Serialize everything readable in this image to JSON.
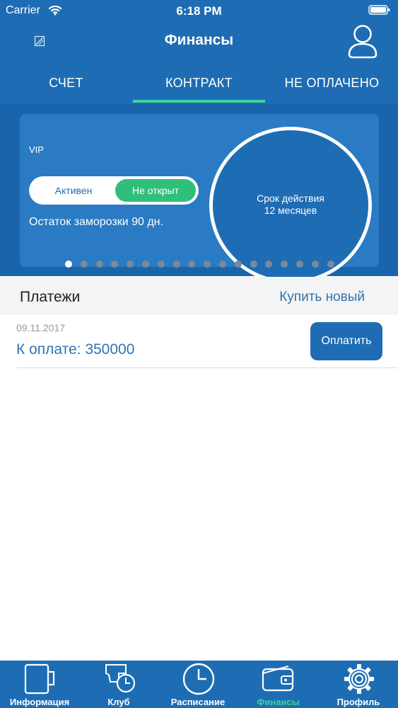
{
  "status_bar": {
    "carrier": "Carrier",
    "time": "6:18 PM"
  },
  "nav": {
    "title": "Финансы",
    "left_icon": "edit-icon",
    "right_icon": "user-icon"
  },
  "tabs": [
    {
      "label": "СЧЕТ"
    },
    {
      "label": "КОНТРАКТ",
      "selected": true
    },
    {
      "label": "НЕ ОПЛАЧЕНО"
    }
  ],
  "contract_card": {
    "type": "VIP",
    "status_left": "Активен",
    "status_right": "Не открыт",
    "freeze_remaining": "Остаток заморозки 90 дн.",
    "validity_line1": "Срок действия",
    "validity_line2": "12 месяцев",
    "page_count": 18,
    "current_page": 1
  },
  "payments": {
    "title": "Платежи",
    "buy_new": "Купить новый",
    "items": [
      {
        "date": "09.11.2017",
        "amount": "К оплате: 350000",
        "pay_label": "Оплатить"
      }
    ]
  },
  "tab_bar": [
    {
      "label": "Информация",
      "icon": "mug-icon"
    },
    {
      "label": "Клуб",
      "icon": "club-clock-icon"
    },
    {
      "label": "Расписание",
      "icon": "clock-icon"
    },
    {
      "label": "Финансы",
      "icon": "wallet-icon",
      "active": true
    },
    {
      "label": "Профиль",
      "icon": "gear-icon"
    }
  ],
  "colors": {
    "primary": "#1e6db4",
    "accent": "#3fd19b",
    "toggle_green": "#2fbf7a",
    "link": "#2f74b3"
  }
}
